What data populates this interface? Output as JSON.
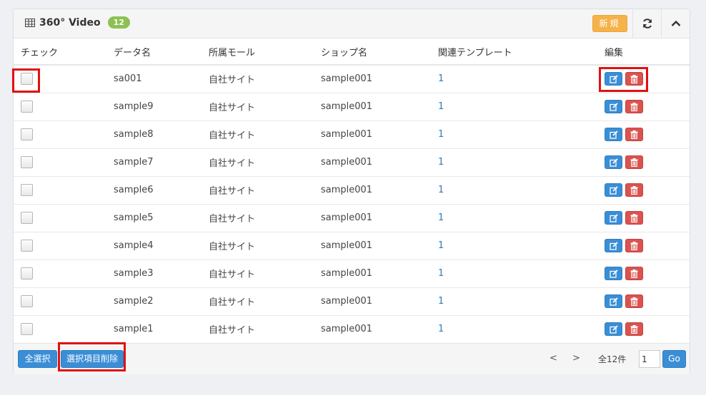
{
  "panel": {
    "title": "360° Video",
    "count": "12",
    "new_label": "新規"
  },
  "table": {
    "headers": [
      "チェック",
      "データ名",
      "所属モール",
      "ショップ名",
      "関連テンプレート",
      "編集"
    ],
    "rows": [
      {
        "name": "sa001",
        "mall": "自社サイト",
        "shop": "sample001",
        "template": "1"
      },
      {
        "name": "sample9",
        "mall": "自社サイト",
        "shop": "sample001",
        "template": "1"
      },
      {
        "name": "sample8",
        "mall": "自社サイト",
        "shop": "sample001",
        "template": "1"
      },
      {
        "name": "sample7",
        "mall": "自社サイト",
        "shop": "sample001",
        "template": "1"
      },
      {
        "name": "sample6",
        "mall": "自社サイト",
        "shop": "sample001",
        "template": "1"
      },
      {
        "name": "sample5",
        "mall": "自社サイト",
        "shop": "sample001",
        "template": "1"
      },
      {
        "name": "sample4",
        "mall": "自社サイト",
        "shop": "sample001",
        "template": "1"
      },
      {
        "name": "sample3",
        "mall": "自社サイト",
        "shop": "sample001",
        "template": "1"
      },
      {
        "name": "sample2",
        "mall": "自社サイト",
        "shop": "sample001",
        "template": "1"
      },
      {
        "name": "sample1",
        "mall": "自社サイト",
        "shop": "sample001",
        "template": "1"
      }
    ]
  },
  "footer": {
    "select_all_label": "全選択",
    "delete_selected_label": "選択項目削除",
    "prev_label": "<",
    "next_label": ">",
    "total_label": "全12件",
    "page_value": "1",
    "go_label": "Go"
  },
  "icons": {
    "title": "table-icon",
    "refresh": "refresh-icon",
    "collapse": "chevron-up-icon",
    "edit": "edit-icon",
    "delete": "trash-icon"
  },
  "colors": {
    "primary": "#3a8ed5",
    "danger": "#d9534f",
    "warning": "#f6b24a",
    "badge": "#8cc152",
    "highlight": "#e01111"
  }
}
